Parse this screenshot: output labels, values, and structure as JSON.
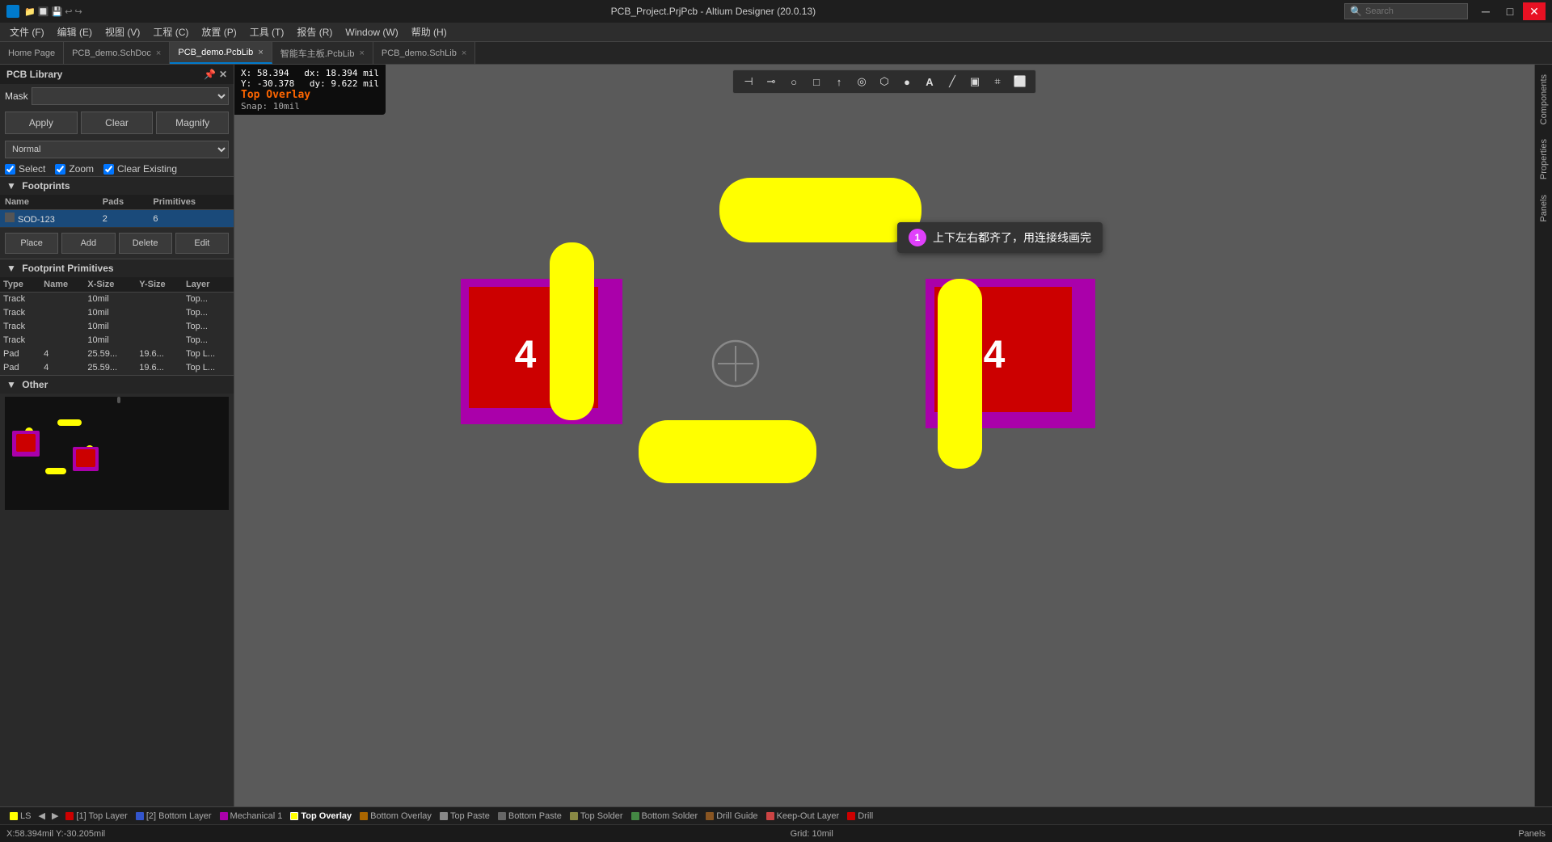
{
  "titlebar": {
    "title": "PCB_Project.PrjPcb - Altium Designer (20.0.13)",
    "search_placeholder": "Search",
    "min_label": "─",
    "max_label": "□",
    "close_label": "✕"
  },
  "menubar": {
    "items": [
      {
        "label": "文件 (F)"
      },
      {
        "label": "编辑 (E)"
      },
      {
        "label": "视图 (V)"
      },
      {
        "label": "工程 (C)"
      },
      {
        "label": "放置 (P)"
      },
      {
        "label": "工具 (T)"
      },
      {
        "label": "报告 (R)"
      },
      {
        "label": "Window (W)"
      },
      {
        "label": "帮助 (H)"
      }
    ]
  },
  "tabbar": {
    "tabs": [
      {
        "label": "Home Page",
        "active": false,
        "dot_color": "#888",
        "closeable": false
      },
      {
        "label": "PCB_demo.SchDoc",
        "active": false,
        "dot_color": "#888",
        "closeable": true
      },
      {
        "label": "PCB_demo.PcbLib",
        "active": true,
        "dot_color": "#888",
        "closeable": true
      },
      {
        "label": "智能车主板.PcbLib",
        "active": false,
        "dot_color": "#888",
        "closeable": true
      },
      {
        "label": "PCB_demo.SchLib",
        "active": false,
        "dot_color": "#888",
        "closeable": true
      }
    ]
  },
  "left_panel": {
    "title": "PCB Library",
    "mask_label": "Mask",
    "mask_placeholder": "",
    "btn_apply": "Apply",
    "btn_clear": "Clear",
    "btn_magnify": "Magnify",
    "normal_options": [
      "Normal"
    ],
    "normal_selected": "Normal",
    "check_select": "Select",
    "check_zoom": "Zoom",
    "check_clear_existing": "Clear Existing",
    "footprints_section": "Footprints",
    "col_name": "Name",
    "col_pads": "Pads",
    "col_primitives": "Primitives",
    "footprints": [
      {
        "name": "SOD-123",
        "pads": "2",
        "primitives": "6",
        "selected": true
      }
    ],
    "btn_place": "Place",
    "btn_add": "Add",
    "btn_delete": "Delete",
    "btn_edit": "Edit",
    "primitives_section": "Footprint Primitives",
    "prim_cols": [
      "Type",
      "Name",
      "X-Size",
      "Y-Size",
      "Layer"
    ],
    "primitives": [
      {
        "type": "Track",
        "name": "",
        "x_size": "10mil",
        "y_size": "",
        "layer": "Top..."
      },
      {
        "type": "Track",
        "name": "",
        "x_size": "10mil",
        "y_size": "",
        "layer": "Top..."
      },
      {
        "type": "Track",
        "name": "",
        "x_size": "10mil",
        "y_size": "",
        "layer": "Top..."
      },
      {
        "type": "Track",
        "name": "",
        "x_size": "10mil",
        "y_size": "",
        "layer": "Top..."
      },
      {
        "type": "Pad",
        "name": "4",
        "x_size": "25.59...",
        "y_size": "19.6...",
        "layer": "Top L..."
      },
      {
        "type": "Pad",
        "name": "4",
        "x_size": "25.59...",
        "y_size": "19.6...",
        "layer": "Top L..."
      }
    ],
    "other_section": "Other"
  },
  "canvas": {
    "coord_x": "X:  58.394",
    "coord_dx": "dx:  18.394 mil",
    "coord_y": "Y: -30.378",
    "coord_dy": "dy:  9.622  mil",
    "layer_name": "Top Overlay",
    "snap_info": "Snap: 10mil"
  },
  "tooltip": {
    "badge": "1",
    "text": "上下左右都齐了，用连接线画完"
  },
  "toolbar": {
    "buttons": [
      {
        "icon": "⊣",
        "title": "Filter"
      },
      {
        "icon": "⊸",
        "title": "Wire"
      },
      {
        "icon": "○",
        "title": "Circle"
      },
      {
        "icon": "□",
        "title": "Rectangle"
      },
      {
        "icon": "↑",
        "title": "Chart"
      },
      {
        "icon": "◎",
        "title": "Place"
      },
      {
        "icon": "⬡",
        "title": "Via"
      },
      {
        "icon": "◉",
        "title": "Pad"
      },
      {
        "icon": "A",
        "title": "Text"
      },
      {
        "icon": "╱",
        "title": "Line"
      },
      {
        "icon": "▣",
        "title": "Region"
      },
      {
        "icon": "⌗",
        "title": "Grid"
      },
      {
        "icon": "⬜",
        "title": "Box"
      }
    ]
  },
  "layer_bar": {
    "ls_label": "LS",
    "layers": [
      {
        "label": "[1] Top Layer",
        "color": "#cc0000",
        "active": false
      },
      {
        "label": "[2] Bottom Layer",
        "color": "#3355cc",
        "active": false
      },
      {
        "label": "Mechanical 1",
        "color": "#aa00aa",
        "active": false
      },
      {
        "label": "Top Overlay",
        "color": "#ffff00",
        "active": true
      },
      {
        "label": "Bottom Overlay",
        "color": "#aa6600",
        "active": false
      },
      {
        "label": "Top Paste",
        "color": "#888888",
        "active": false
      },
      {
        "label": "Bottom Paste",
        "color": "#666666",
        "active": false
      },
      {
        "label": "Top Solder",
        "color": "#888844",
        "active": false
      },
      {
        "label": "Bottom Solder",
        "color": "#448844",
        "active": false
      },
      {
        "label": "Drill Guide",
        "color": "#885522",
        "active": false
      },
      {
        "label": "Keep-Out Layer",
        "color": "#cc4444",
        "active": false
      },
      {
        "label": "Drill",
        "color": "#cc0000",
        "active": false
      }
    ]
  },
  "status_bar": {
    "coords": "X:58.394mil Y:-30.205mil",
    "grid": "Grid: 10mil",
    "panels": "Panels"
  },
  "right_panel": {
    "tabs": [
      {
        "label": "Components"
      },
      {
        "label": "Properties"
      },
      {
        "label": "Panels"
      }
    ]
  }
}
